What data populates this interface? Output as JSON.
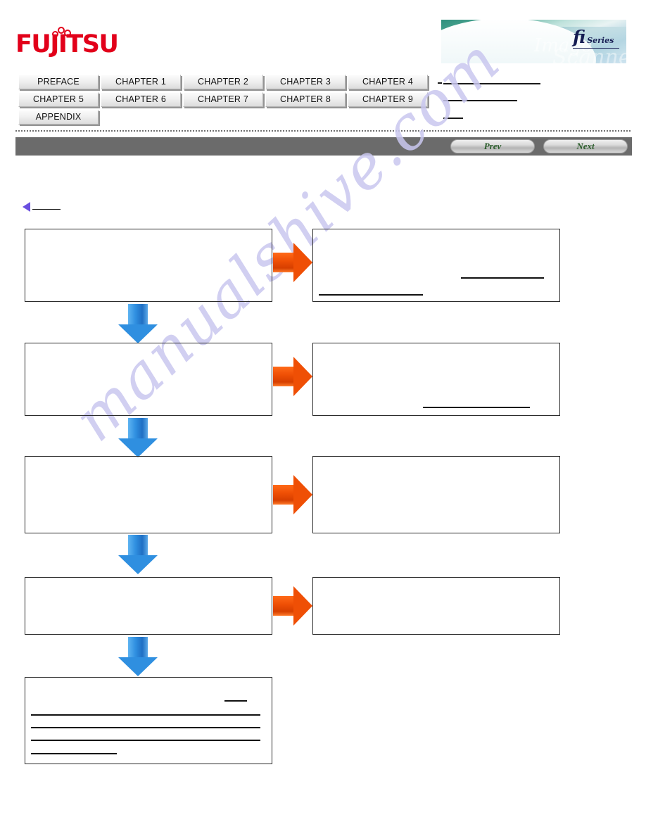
{
  "brand": {
    "logo_text": "FUJITSU",
    "logo_name": "fujitsu-logo",
    "banner": {
      "product_mark": "fi",
      "product_series": "Series",
      "script_word_1": "Image",
      "script_word_2": "Scanner"
    },
    "accent_red": "#e2001a",
    "banner_teal": "#2f8f7d"
  },
  "nav": {
    "tabs_row1": [
      {
        "label": "PREFACE"
      },
      {
        "label": "CHAPTER 1"
      },
      {
        "label": "CHAPTER 2"
      },
      {
        "label": "CHAPTER 3"
      },
      {
        "label": "CHAPTER 4"
      }
    ],
    "tabs_row2": [
      {
        "label": "CHAPTER 5"
      },
      {
        "label": "CHAPTER 6"
      },
      {
        "label": "CHAPTER 7"
      },
      {
        "label": "CHAPTER 8"
      },
      {
        "label": "CHAPTER 9"
      }
    ],
    "tabs_row3": [
      {
        "label": "APPENDIX"
      }
    ],
    "side_links": [
      {
        "label": ""
      },
      {
        "label": ""
      },
      {
        "label": ""
      }
    ]
  },
  "toolbar": {
    "prev_label": "Prev",
    "next_label": "Next",
    "bar_color": "#6b6b6b",
    "button_text_color": "#2a5c2a"
  },
  "back_link": {
    "label": "",
    "arrow_color": "#6a4fe0"
  },
  "watermark": {
    "text": "manualshive.com",
    "color": "#c9c7ef"
  },
  "flow": {
    "down_arrow_color": "#2f8fe0",
    "right_arrow_color": "#ef4f05",
    "box_border_color": "#2b2b2b",
    "steps": [
      {
        "name": "step-1",
        "left_box": {
          "label": "",
          "underlines": []
        },
        "right_box": {
          "label": "",
          "underlines": [
            {
              "label": ""
            },
            {
              "label": ""
            }
          ]
        }
      },
      {
        "name": "step-2",
        "left_box": {
          "label": "",
          "underlines": []
        },
        "right_box": {
          "label": "",
          "underlines": [
            {
              "label": ""
            }
          ]
        }
      },
      {
        "name": "step-3",
        "left_box": {
          "label": "",
          "underlines": []
        },
        "right_box": {
          "label": "",
          "underlines": []
        }
      },
      {
        "name": "step-4",
        "left_box": {
          "label": "",
          "underlines": []
        },
        "right_box": {
          "label": "",
          "underlines": []
        }
      },
      {
        "name": "step-5",
        "left_box": {
          "label": "",
          "underlines": [
            {
              "label": ""
            },
            {
              "label": ""
            },
            {
              "label": ""
            },
            {
              "label": ""
            },
            {
              "label": ""
            }
          ]
        },
        "right_box": null
      }
    ]
  }
}
